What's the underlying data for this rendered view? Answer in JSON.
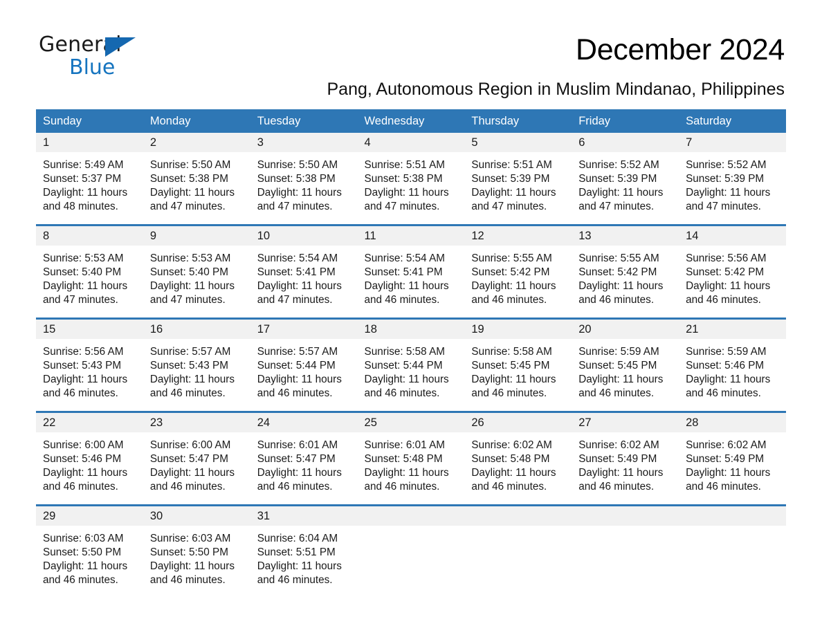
{
  "brand": {
    "name_part1": "General",
    "name_part2": "Blue",
    "triangle_color": "#1568b0",
    "blue_text_color": "#1574bf"
  },
  "header": {
    "title": "December 2024",
    "subtitle": "Pang, Autonomous Region in Muslim Mindanao, Philippines"
  },
  "theme": {
    "header_row_bg": "#2e77b5",
    "daynum_bg": "#f1f1f1",
    "page_bg": "#ffffff",
    "text_color": "#1a1a1a"
  },
  "calendar": {
    "weekday_headers": [
      "Sunday",
      "Monday",
      "Tuesday",
      "Wednesday",
      "Thursday",
      "Friday",
      "Saturday"
    ],
    "weeks": [
      [
        {
          "day": "1",
          "sunrise": "Sunrise: 5:49 AM",
          "sunset": "Sunset: 5:37 PM",
          "daylight_line1": "Daylight: 11 hours",
          "daylight_line2": "and 48 minutes."
        },
        {
          "day": "2",
          "sunrise": "Sunrise: 5:50 AM",
          "sunset": "Sunset: 5:38 PM",
          "daylight_line1": "Daylight: 11 hours",
          "daylight_line2": "and 47 minutes."
        },
        {
          "day": "3",
          "sunrise": "Sunrise: 5:50 AM",
          "sunset": "Sunset: 5:38 PM",
          "daylight_line1": "Daylight: 11 hours",
          "daylight_line2": "and 47 minutes."
        },
        {
          "day": "4",
          "sunrise": "Sunrise: 5:51 AM",
          "sunset": "Sunset: 5:38 PM",
          "daylight_line1": "Daylight: 11 hours",
          "daylight_line2": "and 47 minutes."
        },
        {
          "day": "5",
          "sunrise": "Sunrise: 5:51 AM",
          "sunset": "Sunset: 5:39 PM",
          "daylight_line1": "Daylight: 11 hours",
          "daylight_line2": "and 47 minutes."
        },
        {
          "day": "6",
          "sunrise": "Sunrise: 5:52 AM",
          "sunset": "Sunset: 5:39 PM",
          "daylight_line1": "Daylight: 11 hours",
          "daylight_line2": "and 47 minutes."
        },
        {
          "day": "7",
          "sunrise": "Sunrise: 5:52 AM",
          "sunset": "Sunset: 5:39 PM",
          "daylight_line1": "Daylight: 11 hours",
          "daylight_line2": "and 47 minutes."
        }
      ],
      [
        {
          "day": "8",
          "sunrise": "Sunrise: 5:53 AM",
          "sunset": "Sunset: 5:40 PM",
          "daylight_line1": "Daylight: 11 hours",
          "daylight_line2": "and 47 minutes."
        },
        {
          "day": "9",
          "sunrise": "Sunrise: 5:53 AM",
          "sunset": "Sunset: 5:40 PM",
          "daylight_line1": "Daylight: 11 hours",
          "daylight_line2": "and 47 minutes."
        },
        {
          "day": "10",
          "sunrise": "Sunrise: 5:54 AM",
          "sunset": "Sunset: 5:41 PM",
          "daylight_line1": "Daylight: 11 hours",
          "daylight_line2": "and 47 minutes."
        },
        {
          "day": "11",
          "sunrise": "Sunrise: 5:54 AM",
          "sunset": "Sunset: 5:41 PM",
          "daylight_line1": "Daylight: 11 hours",
          "daylight_line2": "and 46 minutes."
        },
        {
          "day": "12",
          "sunrise": "Sunrise: 5:55 AM",
          "sunset": "Sunset: 5:42 PM",
          "daylight_line1": "Daylight: 11 hours",
          "daylight_line2": "and 46 minutes."
        },
        {
          "day": "13",
          "sunrise": "Sunrise: 5:55 AM",
          "sunset": "Sunset: 5:42 PM",
          "daylight_line1": "Daylight: 11 hours",
          "daylight_line2": "and 46 minutes."
        },
        {
          "day": "14",
          "sunrise": "Sunrise: 5:56 AM",
          "sunset": "Sunset: 5:42 PM",
          "daylight_line1": "Daylight: 11 hours",
          "daylight_line2": "and 46 minutes."
        }
      ],
      [
        {
          "day": "15",
          "sunrise": "Sunrise: 5:56 AM",
          "sunset": "Sunset: 5:43 PM",
          "daylight_line1": "Daylight: 11 hours",
          "daylight_line2": "and 46 minutes."
        },
        {
          "day": "16",
          "sunrise": "Sunrise: 5:57 AM",
          "sunset": "Sunset: 5:43 PM",
          "daylight_line1": "Daylight: 11 hours",
          "daylight_line2": "and 46 minutes."
        },
        {
          "day": "17",
          "sunrise": "Sunrise: 5:57 AM",
          "sunset": "Sunset: 5:44 PM",
          "daylight_line1": "Daylight: 11 hours",
          "daylight_line2": "and 46 minutes."
        },
        {
          "day": "18",
          "sunrise": "Sunrise: 5:58 AM",
          "sunset": "Sunset: 5:44 PM",
          "daylight_line1": "Daylight: 11 hours",
          "daylight_line2": "and 46 minutes."
        },
        {
          "day": "19",
          "sunrise": "Sunrise: 5:58 AM",
          "sunset": "Sunset: 5:45 PM",
          "daylight_line1": "Daylight: 11 hours",
          "daylight_line2": "and 46 minutes."
        },
        {
          "day": "20",
          "sunrise": "Sunrise: 5:59 AM",
          "sunset": "Sunset: 5:45 PM",
          "daylight_line1": "Daylight: 11 hours",
          "daylight_line2": "and 46 minutes."
        },
        {
          "day": "21",
          "sunrise": "Sunrise: 5:59 AM",
          "sunset": "Sunset: 5:46 PM",
          "daylight_line1": "Daylight: 11 hours",
          "daylight_line2": "and 46 minutes."
        }
      ],
      [
        {
          "day": "22",
          "sunrise": "Sunrise: 6:00 AM",
          "sunset": "Sunset: 5:46 PM",
          "daylight_line1": "Daylight: 11 hours",
          "daylight_line2": "and 46 minutes."
        },
        {
          "day": "23",
          "sunrise": "Sunrise: 6:00 AM",
          "sunset": "Sunset: 5:47 PM",
          "daylight_line1": "Daylight: 11 hours",
          "daylight_line2": "and 46 minutes."
        },
        {
          "day": "24",
          "sunrise": "Sunrise: 6:01 AM",
          "sunset": "Sunset: 5:47 PM",
          "daylight_line1": "Daylight: 11 hours",
          "daylight_line2": "and 46 minutes."
        },
        {
          "day": "25",
          "sunrise": "Sunrise: 6:01 AM",
          "sunset": "Sunset: 5:48 PM",
          "daylight_line1": "Daylight: 11 hours",
          "daylight_line2": "and 46 minutes."
        },
        {
          "day": "26",
          "sunrise": "Sunrise: 6:02 AM",
          "sunset": "Sunset: 5:48 PM",
          "daylight_line1": "Daylight: 11 hours",
          "daylight_line2": "and 46 minutes."
        },
        {
          "day": "27",
          "sunrise": "Sunrise: 6:02 AM",
          "sunset": "Sunset: 5:49 PM",
          "daylight_line1": "Daylight: 11 hours",
          "daylight_line2": "and 46 minutes."
        },
        {
          "day": "28",
          "sunrise": "Sunrise: 6:02 AM",
          "sunset": "Sunset: 5:49 PM",
          "daylight_line1": "Daylight: 11 hours",
          "daylight_line2": "and 46 minutes."
        }
      ],
      [
        {
          "day": "29",
          "sunrise": "Sunrise: 6:03 AM",
          "sunset": "Sunset: 5:50 PM",
          "daylight_line1": "Daylight: 11 hours",
          "daylight_line2": "and 46 minutes."
        },
        {
          "day": "30",
          "sunrise": "Sunrise: 6:03 AM",
          "sunset": "Sunset: 5:50 PM",
          "daylight_line1": "Daylight: 11 hours",
          "daylight_line2": "and 46 minutes."
        },
        {
          "day": "31",
          "sunrise": "Sunrise: 6:04 AM",
          "sunset": "Sunset: 5:51 PM",
          "daylight_line1": "Daylight: 11 hours",
          "daylight_line2": "and 46 minutes."
        },
        {
          "day": "",
          "sunrise": "",
          "sunset": "",
          "daylight_line1": "",
          "daylight_line2": ""
        },
        {
          "day": "",
          "sunrise": "",
          "sunset": "",
          "daylight_line1": "",
          "daylight_line2": ""
        },
        {
          "day": "",
          "sunrise": "",
          "sunset": "",
          "daylight_line1": "",
          "daylight_line2": ""
        },
        {
          "day": "",
          "sunrise": "",
          "sunset": "",
          "daylight_line1": "",
          "daylight_line2": ""
        }
      ]
    ]
  }
}
